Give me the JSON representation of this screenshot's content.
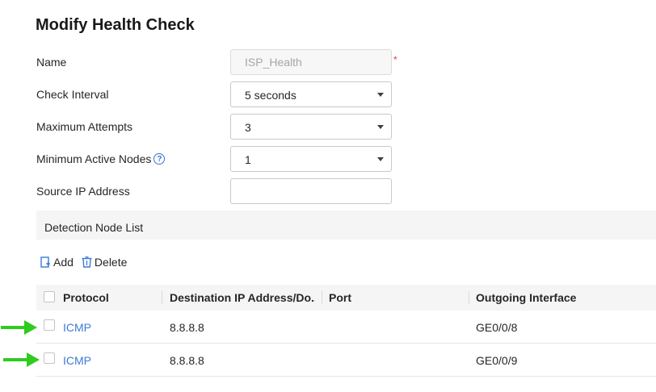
{
  "page": {
    "title": "Modify Health Check"
  },
  "form": {
    "name": {
      "label": "Name",
      "value": "ISP_Health",
      "required_mark": "*"
    },
    "check_interval": {
      "label": "Check Interval",
      "value": "5 seconds"
    },
    "max_attempts": {
      "label": "Maximum Attempts",
      "value": "3"
    },
    "min_active_nodes": {
      "label": "Minimum Active Nodes",
      "value": "1",
      "help_glyph": "?"
    },
    "source_ip": {
      "label": "Source IP Address",
      "value": ""
    }
  },
  "section": {
    "title": "Detection Node List"
  },
  "toolbar": {
    "add_label": "Add",
    "delete_label": "Delete"
  },
  "table": {
    "columns": [
      "Protocol",
      "Destination IP Address/Do...",
      "Port",
      "Outgoing Interface"
    ],
    "rows": [
      {
        "protocol": "ICMP",
        "destination": "8.8.8.8",
        "port": "",
        "interface": "GE0/0/8"
      },
      {
        "protocol": "ICMP",
        "destination": "8.8.8.8",
        "port": "",
        "interface": "GE0/0/9"
      }
    ]
  },
  "colors": {
    "accent": "#3a7bd5",
    "required": "#e5393f",
    "arrow": "#2ecc1f"
  }
}
